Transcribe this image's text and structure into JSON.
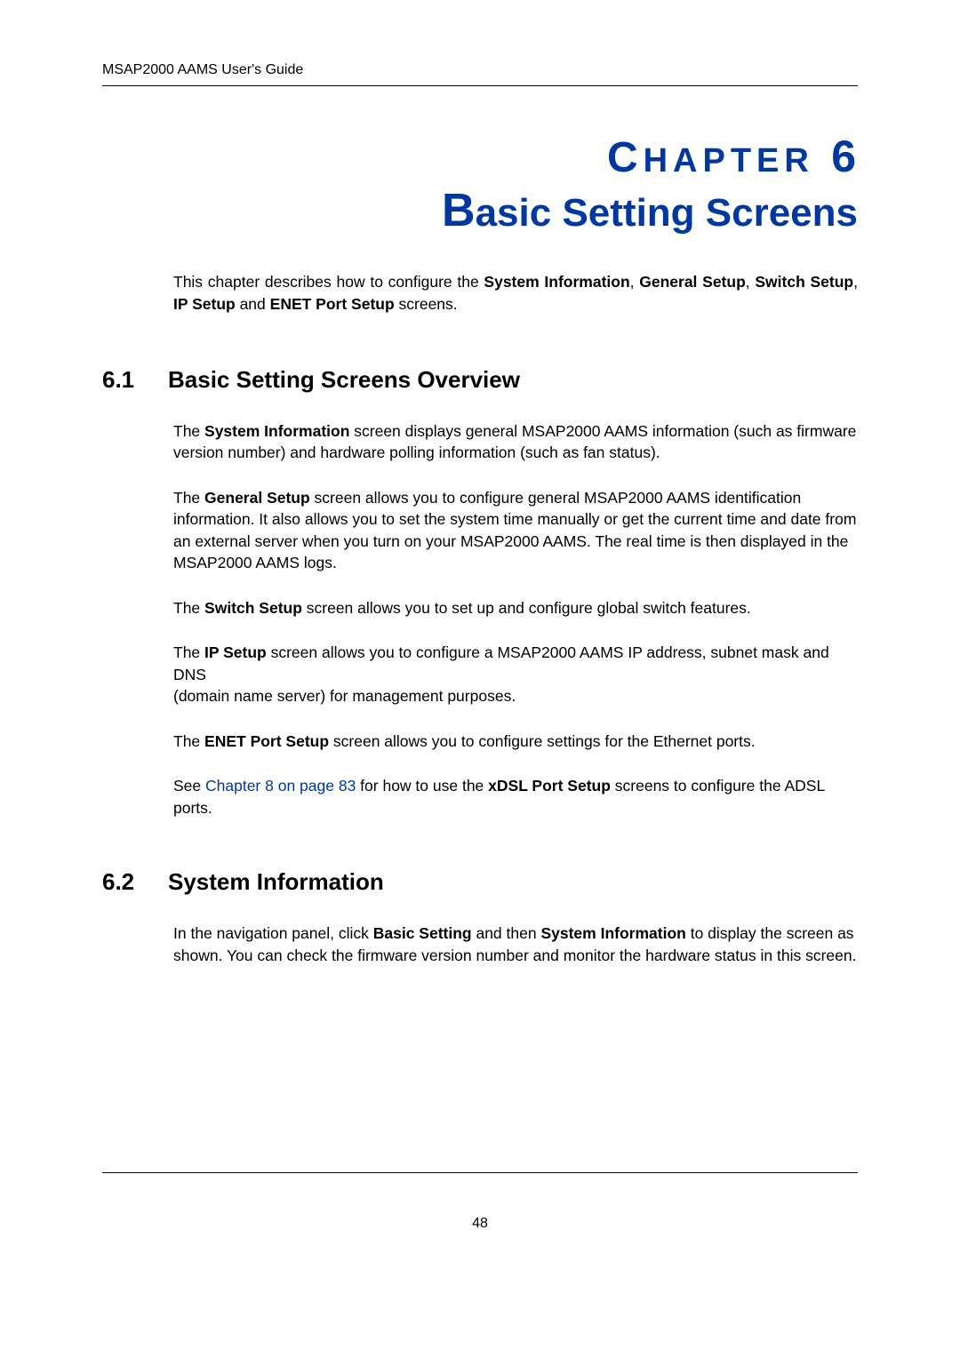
{
  "running_head": "MSAP2000 AAMS User's Guide",
  "chapter": {
    "label_small": "HAPTER",
    "label_first": "C",
    "number": "6",
    "title_first": "B",
    "title_rest": "asic Setting Screens"
  },
  "intro": {
    "pre": "This chapter describes how to configure the ",
    "b1": "System Information",
    "sep1": ", ",
    "b2": "General Setup",
    "sep2": ", ",
    "b3": "Switch Setup",
    "sep3": ", ",
    "b4": "IP Setup",
    "sep4": " and ",
    "b5": "ENET Port Setup",
    "post": " screens."
  },
  "sec61": {
    "num": "6.1",
    "title": "Basic Setting Screens Overview",
    "p1": {
      "pre": "The ",
      "b": "System Information",
      "post": " screen displays general MSAP2000 AAMS information (such as firmware version number) and hardware polling information (such as fan status)."
    },
    "p2": {
      "pre": "The ",
      "b": "General Setup",
      "post": " screen allows you to configure general MSAP2000 AAMS identification information. It also allows you to set the system time manually or get the current time and date from an external server when you turn on your MSAP2000 AAMS. The real time is then displayed in the MSAP2000 AAMS logs."
    },
    "p3": {
      "pre": "The ",
      "b": "Switch Setup",
      "post": " screen allows you to set up and configure global switch features."
    },
    "p4": {
      "pre": "The ",
      "b": "IP Setup",
      "post1": " screen allows you to configure a MSAP2000 AAMS IP address, subnet mask and DNS",
      "line2": "(domain name server) for management purposes."
    },
    "p5": {
      "pre": "The ",
      "b": "ENET Port Setup",
      "post": " screen allows you to configure settings for the Ethernet ports."
    },
    "p6": {
      "pre": "See ",
      "link": "Chapter 8 on page 83",
      "mid": " for how to use the ",
      "b": "xDSL Port Setup",
      "post": " screens to configure the ADSL",
      "line2": "ports."
    }
  },
  "sec62": {
    "num": "6.2",
    "title": "System Information",
    "p1": {
      "pre": "In the navigation panel, click ",
      "b1": "Basic Setting",
      "mid": " and then ",
      "b2": "System Information",
      "post": " to display the screen as shown. You can check the firmware version number and monitor the hardware status in this screen."
    }
  },
  "page_number": "48"
}
